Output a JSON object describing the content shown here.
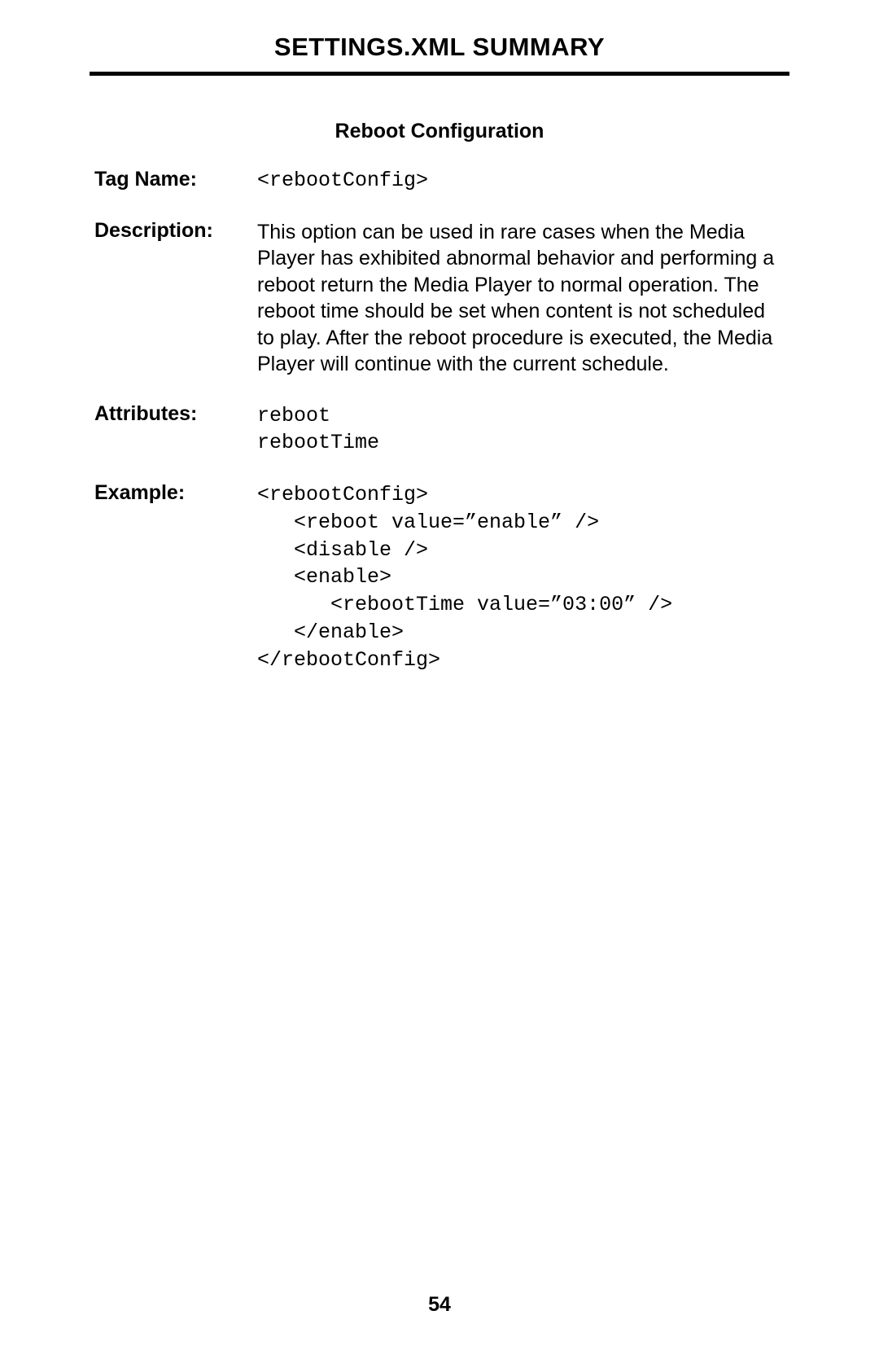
{
  "header": {
    "title": "SETTINGS.XML SUMMARY"
  },
  "section": {
    "title": "Reboot Configuration"
  },
  "rows": {
    "tagName": {
      "label": "Tag Name:",
      "value": "<rebootConfig>"
    },
    "description": {
      "label": "Description:",
      "value": "This option can be used in rare cases when the Media Player has exhibited abnormal behavior and performing a reboot return the Media Player to normal operation.  The reboot time should be set when content is not scheduled to play.  After the reboot procedure is executed, the Media Player will continue with the current schedule."
    },
    "attributes": {
      "label": "Attributes:",
      "value": "reboot\nrebootTime"
    },
    "example": {
      "label": "Example:",
      "value": "<rebootConfig>\n   <reboot value=”enable” />\n   <disable />\n   <enable>\n      <rebootTime value=”03:00” />\n   </enable>\n</rebootConfig>"
    }
  },
  "pageNumber": "54"
}
